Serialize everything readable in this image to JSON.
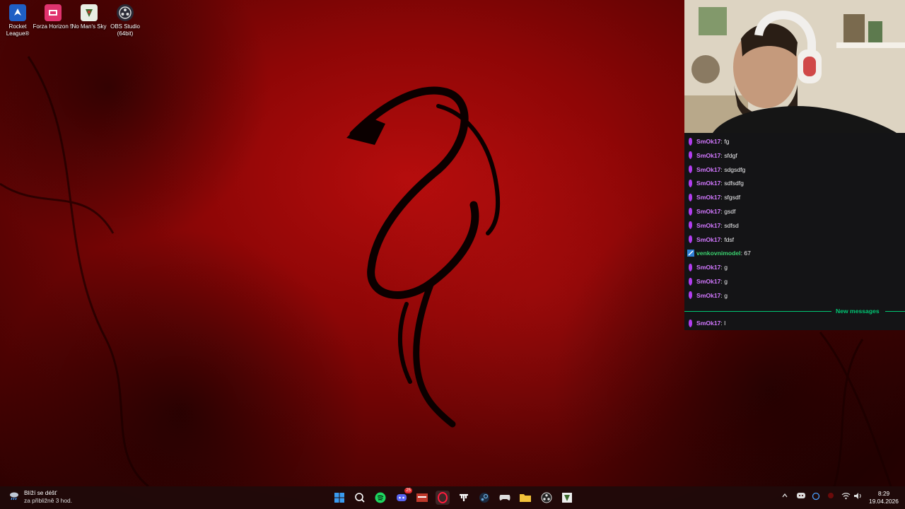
{
  "desktop": {
    "icons": [
      {
        "label": "Rocket League®",
        "icon": "rocket-league-icon",
        "color": "#2a6fd1"
      },
      {
        "label": "Forza Horizon 5",
        "icon": "forza-horizon-icon",
        "color": "#e0336e"
      },
      {
        "label": "No Man's Sky",
        "icon": "no-mans-sky-icon",
        "color": "#6a8a5a"
      },
      {
        "label": "OBS Studio (64bit)",
        "icon": "obs-studio-icon",
        "color": "#303040"
      }
    ]
  },
  "chat": {
    "messages": [
      {
        "user": "SmOk17",
        "text": "fg",
        "badge": "purple"
      },
      {
        "user": "SmOk17",
        "text": "sfdgf",
        "badge": "purple"
      },
      {
        "user": "SmOk17",
        "text": "sdgsdfg",
        "badge": "purple"
      },
      {
        "user": "SmOk17",
        "text": "sdfsdfg",
        "badge": "purple"
      },
      {
        "user": "SmOk17",
        "text": "sfgsdf",
        "badge": "purple"
      },
      {
        "user": "SmOk17",
        "text": "gsdf",
        "badge": "purple"
      },
      {
        "user": "SmOk17",
        "text": "sdfsd",
        "badge": "purple"
      },
      {
        "user": "SmOk17",
        "text": "fdsf",
        "badge": "purple"
      },
      {
        "user": "venkovnimodel",
        "text": "67",
        "badge": "blue"
      },
      {
        "user": "SmOk17",
        "text": "g",
        "badge": "purple"
      },
      {
        "user": "SmOk17",
        "text": "g",
        "badge": "purple"
      },
      {
        "user": "SmOk17",
        "text": "g",
        "badge": "purple"
      }
    ],
    "new_messages_label": "New messages",
    "after": {
      "user": "SmOk17",
      "text": "l"
    },
    "colors": {
      "smok": "#d278ff",
      "venkovni": "#3bd16f",
      "accent": "#00c774"
    }
  },
  "taskbar": {
    "weather_line1": "Blíží se déšť",
    "weather_line2": "za přibližně 3 hod.",
    "time": "8:29",
    "date": "19.04.2026",
    "apps": [
      {
        "icon": "windows-start-icon",
        "color": "#3a9bf0"
      },
      {
        "icon": "search-icon",
        "color": "#ffffff"
      },
      {
        "icon": "spotify-icon",
        "color": "#1ed760"
      },
      {
        "icon": "discord-icon",
        "color": "#5865f2"
      },
      {
        "icon": "shop-app-icon",
        "color": "#c0392b"
      },
      {
        "icon": "opera-gx-icon",
        "color": "#ff1b3d"
      },
      {
        "icon": "tidal-icon",
        "color": "#ffffff"
      },
      {
        "icon": "steam-icon",
        "color": "#6aa8d8"
      },
      {
        "icon": "controller-app-icon",
        "color": "#dddddd"
      },
      {
        "icon": "file-explorer-icon",
        "color": "#f3c23a"
      },
      {
        "icon": "obs-studio-icon",
        "color": "#dddddd"
      },
      {
        "icon": "no-mans-sky-icon",
        "color": "#eeeeee"
      }
    ],
    "discord_badge": "25",
    "tray_icons": [
      "chevron-up-icon",
      "discord-tray-icon",
      "sync-tray-icon",
      "record-tray-icon",
      "wifi-icon",
      "volume-icon"
    ]
  }
}
